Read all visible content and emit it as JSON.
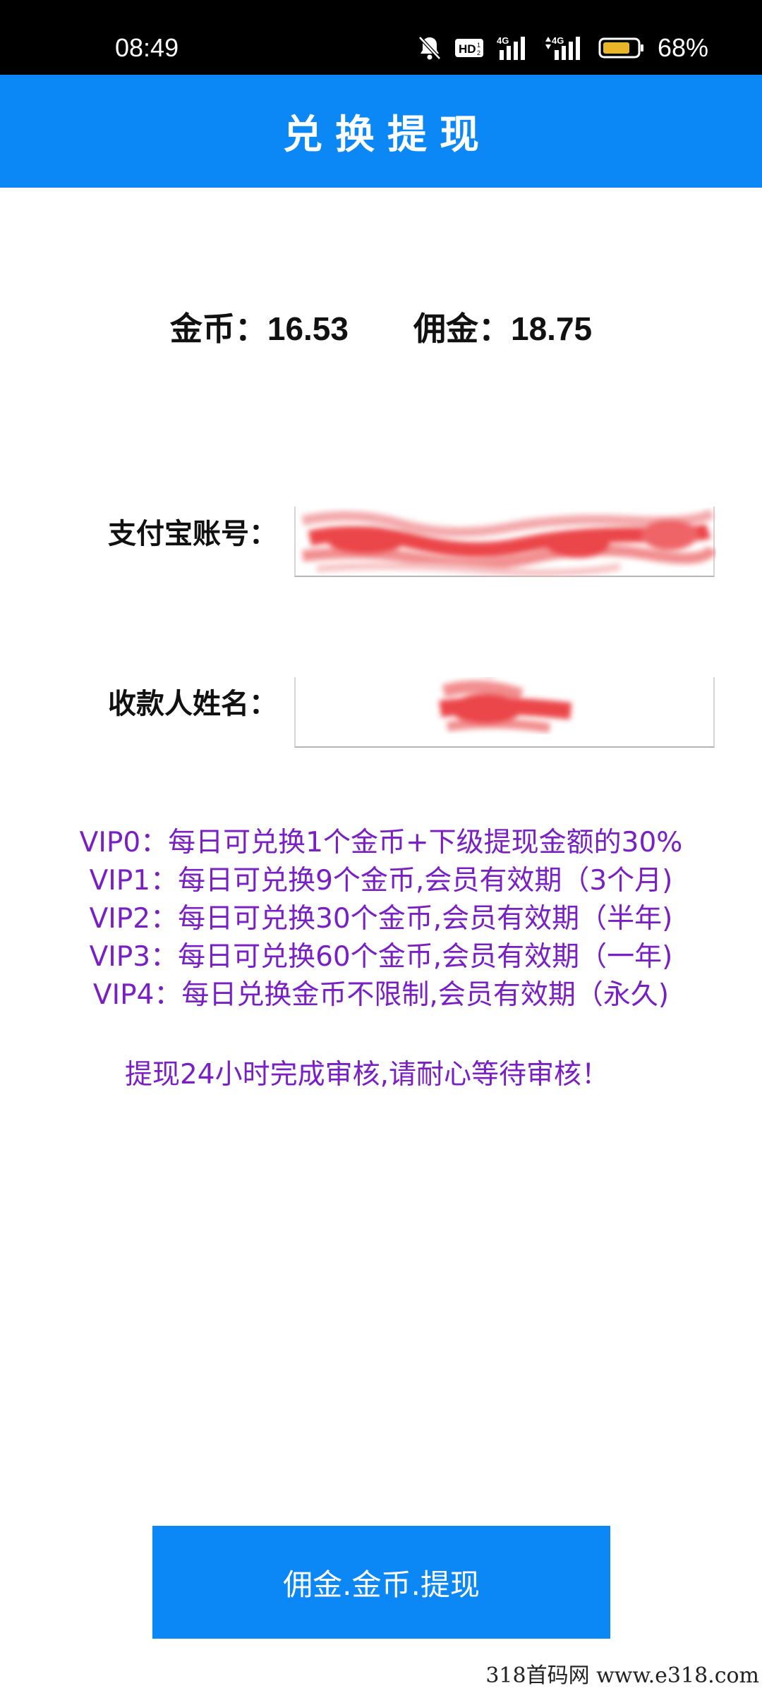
{
  "status_bar": {
    "time": "08:49",
    "battery": "68%",
    "icons": [
      "bell-off-icon",
      "hd-icon",
      "signal-4g-icon",
      "signal-4g-icon",
      "battery-icon"
    ]
  },
  "header": {
    "title": "兑换提现"
  },
  "balance": {
    "coin_label": "金币：",
    "coin_value": "16.53",
    "commission_label": "佣金：",
    "commission_value": "18.75"
  },
  "form": {
    "alipay_label": "支付宝账号：",
    "alipay_value": "",
    "payee_label": "收款人姓名：",
    "payee_value": ""
  },
  "vip_rules": [
    "VIP0：每日可兑换1个金币+下级提现金额的30%",
    "VIP1：每日可兑换9个金币,会员有效期（3个月)",
    "VIP2：每日可兑换30个金币,会员有效期（半年)",
    "VIP3：每日可兑换60个金币,会员有效期（一年)",
    "VIP4：每日兑换金币不限制,会员有效期（永久)"
  ],
  "notice": "提现24小时完成审核,请耐心等待审核！",
  "button": {
    "withdraw_label": "佣金.金币.提现"
  },
  "watermark": "318首码网  www.e318.com",
  "colors": {
    "primary": "#0b88f5",
    "vip_text": "#7a1fc4",
    "redaction": "#e8262b"
  }
}
